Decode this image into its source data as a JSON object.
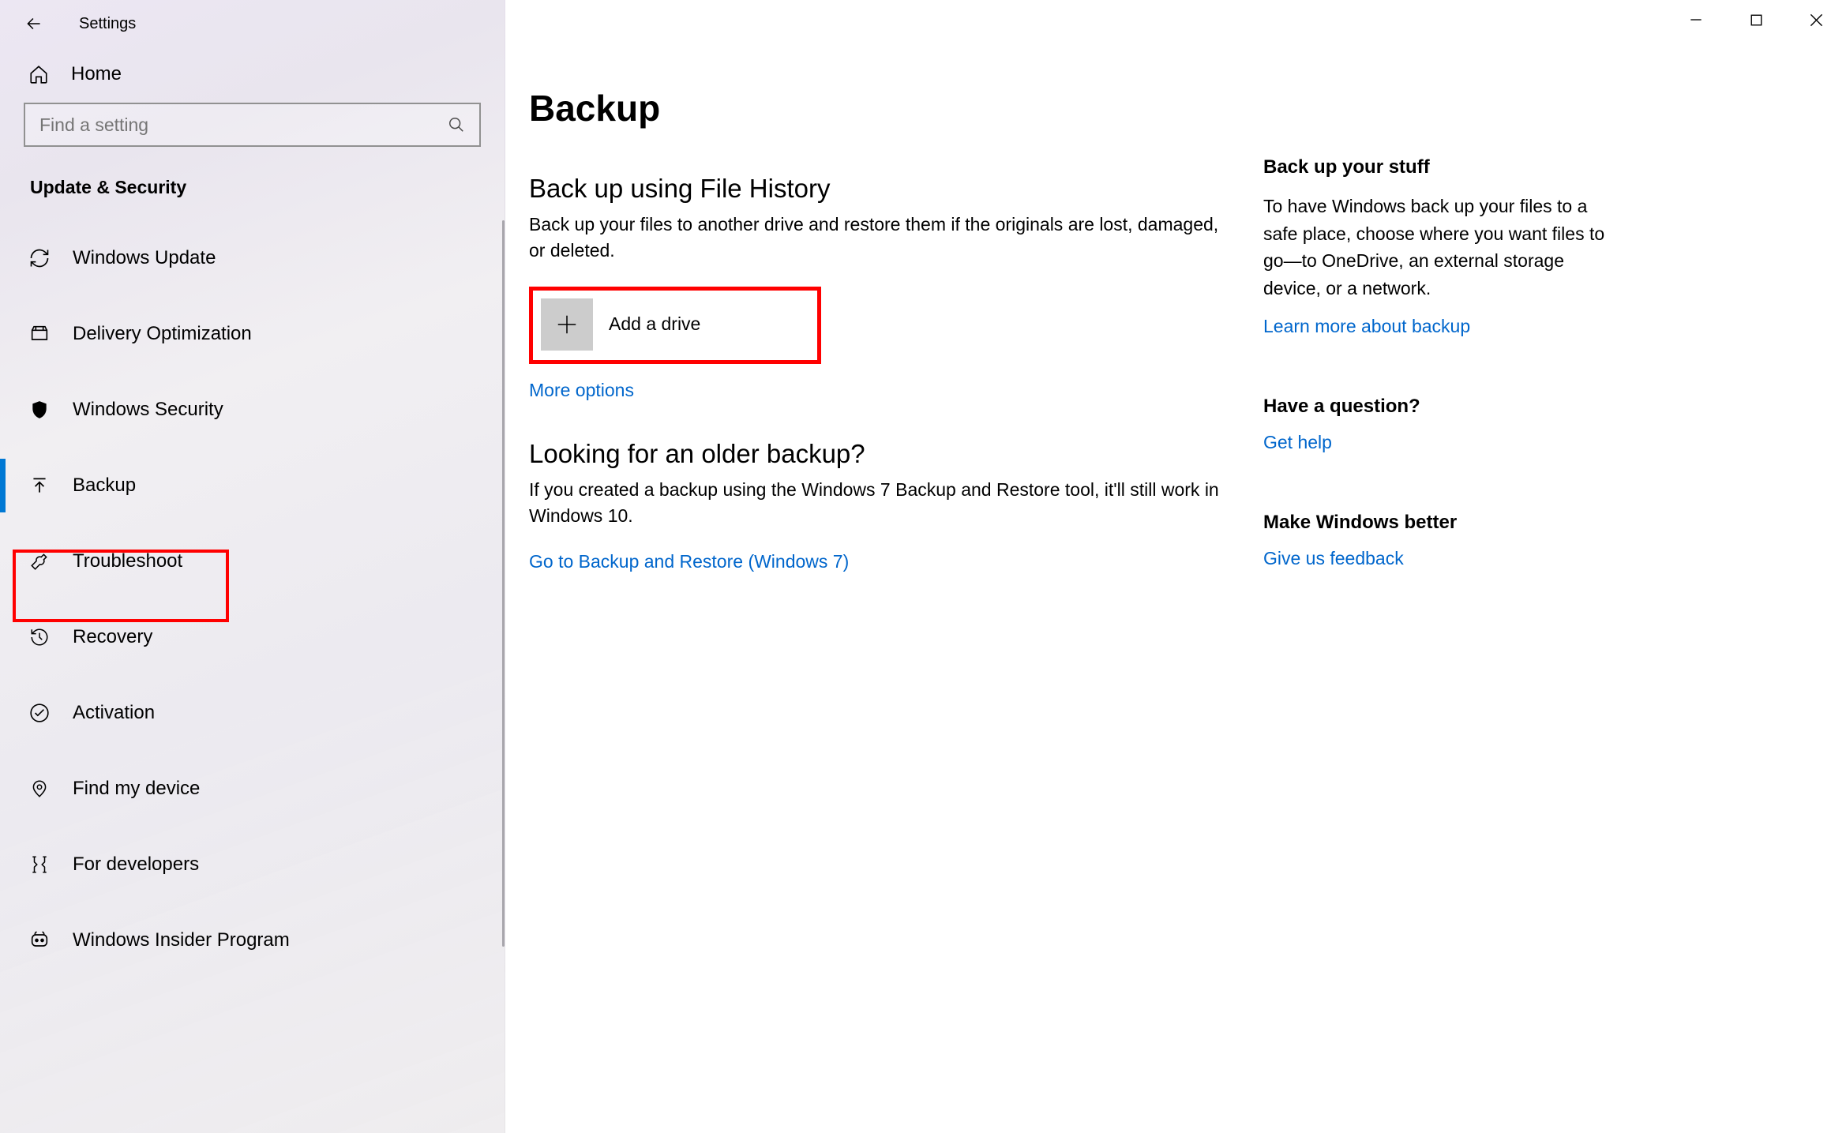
{
  "titlebar": {
    "title": "Settings"
  },
  "sidebar": {
    "home_label": "Home",
    "search_placeholder": "Find a setting",
    "category": "Update & Security",
    "items": [
      {
        "label": "Windows Update"
      },
      {
        "label": "Delivery Optimization"
      },
      {
        "label": "Windows Security"
      },
      {
        "label": "Backup"
      },
      {
        "label": "Troubleshoot"
      },
      {
        "label": "Recovery"
      },
      {
        "label": "Activation"
      },
      {
        "label": "Find my device"
      },
      {
        "label": "For developers"
      },
      {
        "label": "Windows Insider Program"
      }
    ]
  },
  "page": {
    "title": "Backup",
    "section1_title": "Back up using File History",
    "section1_body": "Back up your files to another drive and restore them if the originals are lost, damaged, or deleted.",
    "add_drive_label": "Add a drive",
    "more_options": "More options",
    "section2_title": "Looking for an older backup?",
    "section2_body": "If you created a backup using the Windows 7 Backup and Restore tool, it'll still work in Windows 10.",
    "restore_link": "Go to Backup and Restore (Windows 7)"
  },
  "aside": {
    "stuff_title": "Back up your stuff",
    "stuff_body": "To have Windows back up your files to a safe place, choose where you want files to go—to OneDrive, an external storage device, or a network.",
    "stuff_link": "Learn more about backup",
    "question_title": "Have a question?",
    "question_link": "Get help",
    "better_title": "Make Windows better",
    "better_link": "Give us feedback"
  }
}
